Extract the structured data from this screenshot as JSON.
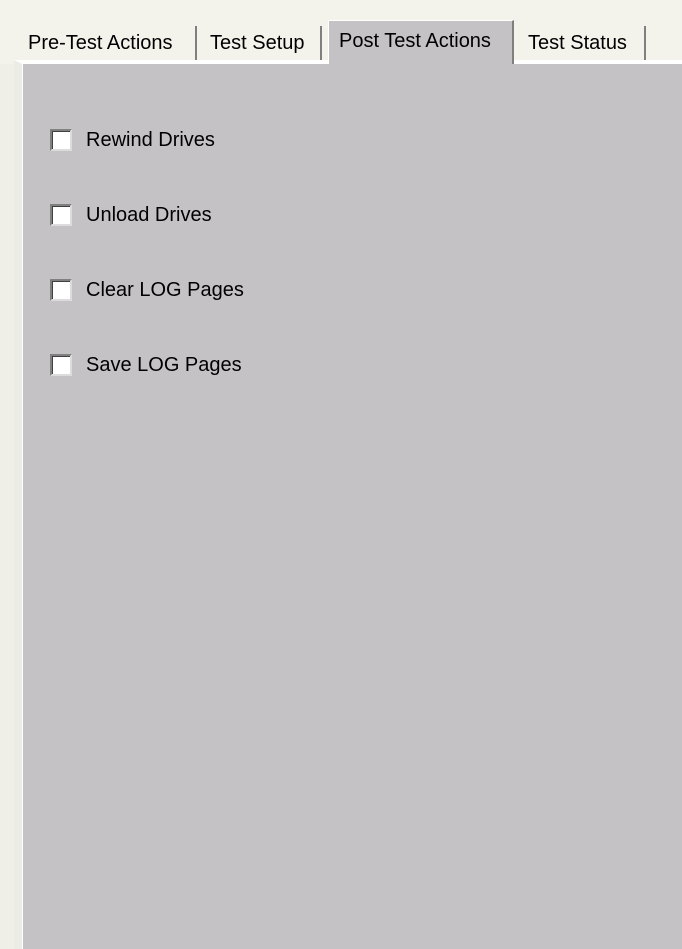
{
  "tabs": [
    {
      "label": "Pre-Test Actions",
      "active": false
    },
    {
      "label": "Test Setup",
      "active": false
    },
    {
      "label": "Post Test Actions",
      "active": true
    },
    {
      "label": "Test Status",
      "active": false
    }
  ],
  "options": [
    {
      "label": "Rewind Drives",
      "checked": false
    },
    {
      "label": "Unload Drives",
      "checked": false
    },
    {
      "label": "Clear LOG Pages",
      "checked": false
    },
    {
      "label": "Save LOG Pages",
      "checked": false
    }
  ],
  "colors": {
    "panel_background": "#c5c2c6",
    "window_background": "#efefe7"
  }
}
